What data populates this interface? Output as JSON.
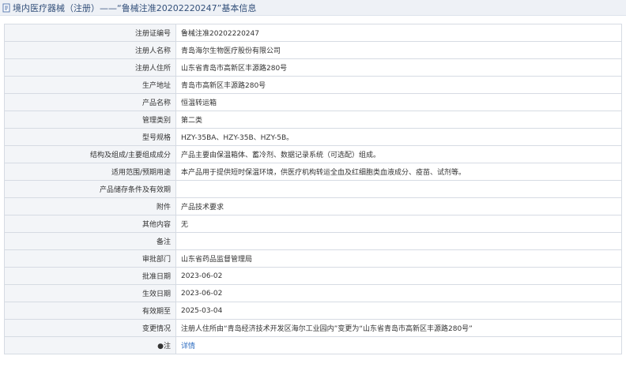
{
  "header": {
    "title": "境内医疗器械（注册）——“鲁械注准20202220247”基本信息",
    "icon": "document-icon"
  },
  "colors": {
    "header_bg": "#eef1f6",
    "label_bg": "#f3f5f8",
    "border": "#d6dbe3",
    "link": "#2d6cc0"
  },
  "rows": [
    {
      "label": "注册证编号",
      "value": "鲁械注准20202220247"
    },
    {
      "label": "注册人名称",
      "value": "青岛海尔生物医疗股份有限公司"
    },
    {
      "label": "注册人住所",
      "value": "山东省青岛市高新区丰源路280号"
    },
    {
      "label": "生产地址",
      "value": "青岛市高新区丰源路280号"
    },
    {
      "label": "产品名称",
      "value": "恒温转运箱"
    },
    {
      "label": "管理类别",
      "value": "第二类"
    },
    {
      "label": "型号规格",
      "value": "HZY-35BA、HZY-35B、HZY-5B。"
    },
    {
      "label": "结构及组成/主要组成成分",
      "value": "产品主要由保温箱体、蓄冷剂、数据记录系统（可选配）组成。"
    },
    {
      "label": "适用范围/预期用途",
      "value": "本产品用于提供短时保温环境，供医疗机构转运全血及红细胞类血液成分、疫苗、试剂等。"
    },
    {
      "label": "产品储存条件及有效期",
      "value": ""
    },
    {
      "label": "附件",
      "value": "产品技术要求"
    },
    {
      "label": "其他内容",
      "value": "无"
    },
    {
      "label": "备注",
      "value": ""
    },
    {
      "label": "审批部门",
      "value": "山东省药品监督管理局"
    },
    {
      "label": "批准日期",
      "value": "2023-06-02"
    },
    {
      "label": "生效日期",
      "value": "2023-06-02"
    },
    {
      "label": "有效期至",
      "value": "2025-03-04"
    },
    {
      "label": "变更情况",
      "value": "注册人住所由“青岛经济技术开发区海尔工业园内”变更为“山东省青岛市高新区丰源路280号”"
    }
  ],
  "note_row": {
    "label": "●注",
    "link_text": "详情"
  }
}
